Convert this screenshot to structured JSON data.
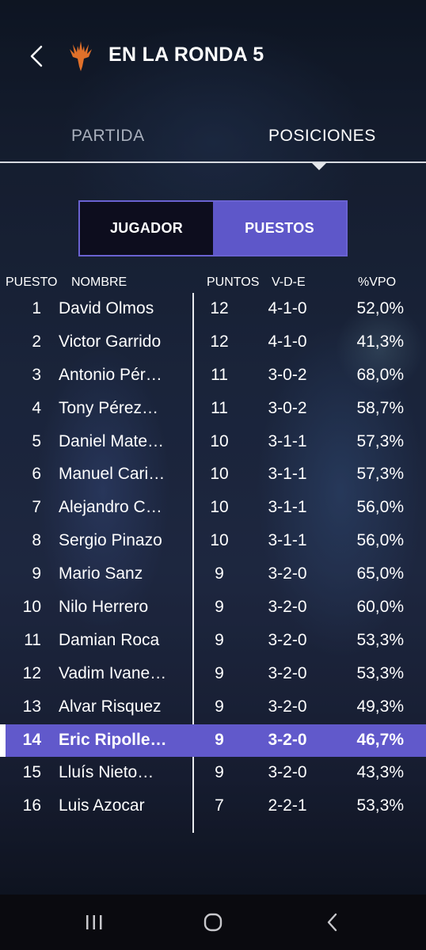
{
  "header": {
    "title": "EN LA RONDA 5"
  },
  "tabs": {
    "partida": "PARTIDA",
    "posiciones": "POSICIONES"
  },
  "segment": {
    "jugador": "JUGADOR",
    "puestos": "PUESTOS"
  },
  "table": {
    "headers": {
      "puesto": "PUESTO",
      "nombre": "NOMBRE",
      "puntos": "PUNTOS",
      "vde": "V-D-E",
      "vpo": "%VPO"
    },
    "rows": [
      {
        "pos": "1",
        "name": "David Olmos",
        "pts": "12",
        "vde": "4-1-0",
        "vpo": "52,0%"
      },
      {
        "pos": "2",
        "name": "Victor Garrido",
        "pts": "12",
        "vde": "4-1-0",
        "vpo": "41,3%"
      },
      {
        "pos": "3",
        "name": "Antonio Pér…",
        "pts": "11",
        "vde": "3-0-2",
        "vpo": "68,0%"
      },
      {
        "pos": "4",
        "name": "Tony Pérez…",
        "pts": "11",
        "vde": "3-0-2",
        "vpo": "58,7%"
      },
      {
        "pos": "5",
        "name": "Daniel Mate…",
        "pts": "10",
        "vde": "3-1-1",
        "vpo": "57,3%"
      },
      {
        "pos": "6",
        "name": "Manuel Cari…",
        "pts": "10",
        "vde": "3-1-1",
        "vpo": "57,3%"
      },
      {
        "pos": "7",
        "name": "Alejandro C…",
        "pts": "10",
        "vde": "3-1-1",
        "vpo": "56,0%"
      },
      {
        "pos": "8",
        "name": "Sergio Pinazo",
        "pts": "10",
        "vde": "3-1-1",
        "vpo": "56,0%"
      },
      {
        "pos": "9",
        "name": "Mario Sanz",
        "pts": "9",
        "vde": "3-2-0",
        "vpo": "65,0%"
      },
      {
        "pos": "10",
        "name": "Nilo Herrero",
        "pts": "9",
        "vde": "3-2-0",
        "vpo": "60,0%"
      },
      {
        "pos": "11",
        "name": "Damian Roca",
        "pts": "9",
        "vde": "3-2-0",
        "vpo": "53,3%"
      },
      {
        "pos": "12",
        "name": "Vadim Ivane…",
        "pts": "9",
        "vde": "3-2-0",
        "vpo": "53,3%"
      },
      {
        "pos": "13",
        "name": "Alvar Risquez",
        "pts": "9",
        "vde": "3-2-0",
        "vpo": "49,3%"
      },
      {
        "pos": "14",
        "name": "Eric Ripolle…",
        "pts": "9",
        "vde": "3-2-0",
        "vpo": "46,7%",
        "highlight": true
      },
      {
        "pos": "15",
        "name": "Lluís  Nieto…",
        "pts": "9",
        "vde": "3-2-0",
        "vpo": "43,3%"
      },
      {
        "pos": "16",
        "name": "Luis Azocar",
        "pts": "7",
        "vde": "2-2-1",
        "vpo": "53,3%"
      }
    ]
  },
  "icons": {
    "back": "chevron-left-icon",
    "logo": "planeswalker-logo-icon",
    "nav_recent": "recent-apps-icon",
    "nav_home": "home-icon",
    "nav_back": "nav-back-icon"
  },
  "colors": {
    "accent": "#5e57c9",
    "highlight": "#6159cb",
    "logo": "#e0702a"
  }
}
